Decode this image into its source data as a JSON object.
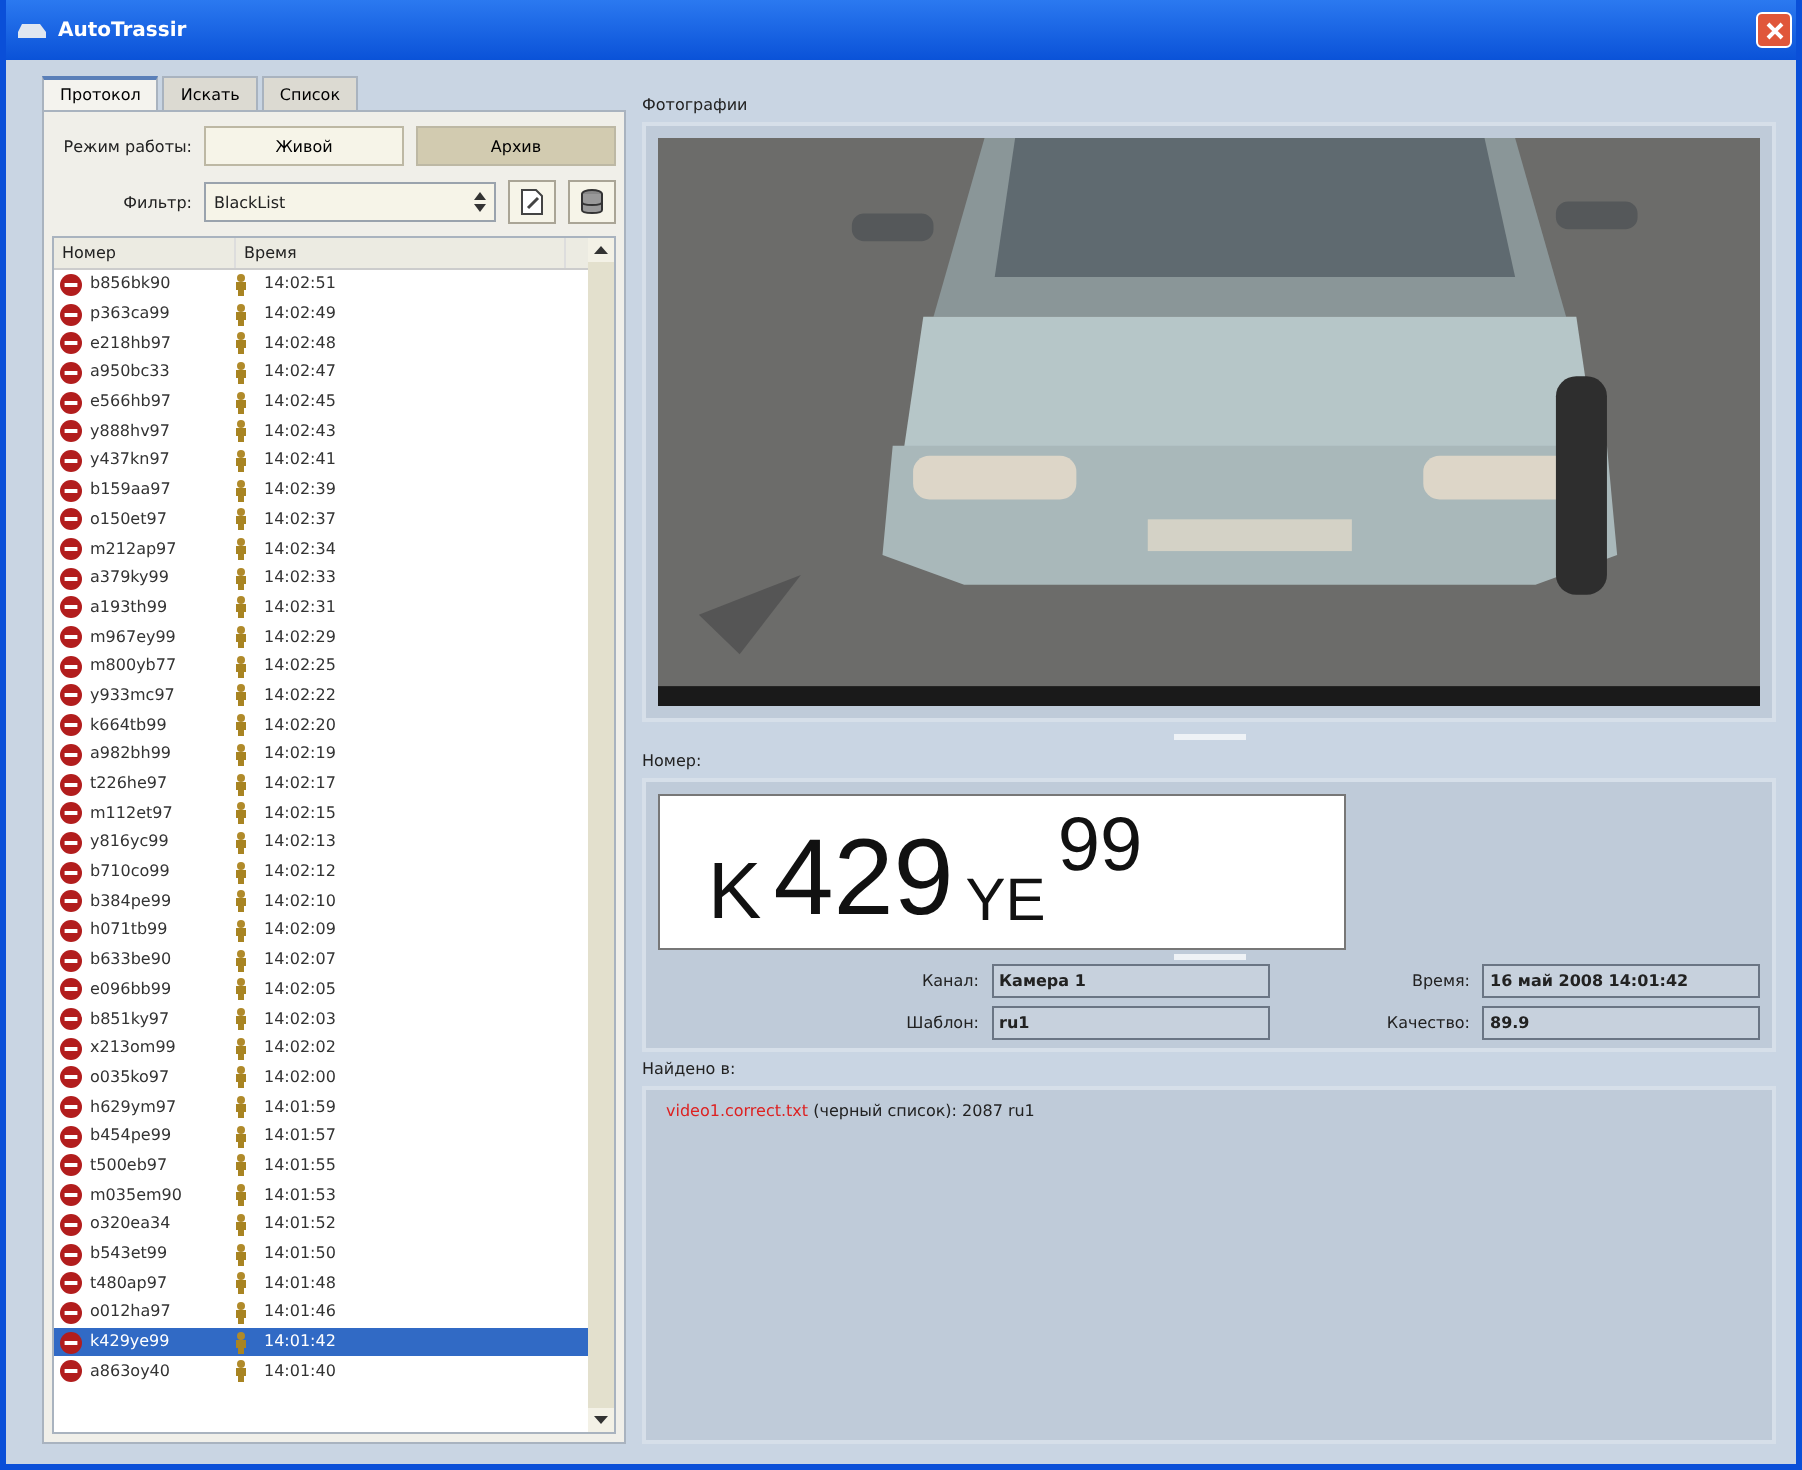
{
  "window": {
    "title": "AutoTrassir"
  },
  "tabs": [
    {
      "label": "Протокол",
      "selected": true
    },
    {
      "label": "Искать",
      "selected": false
    },
    {
      "label": "Список",
      "selected": false
    }
  ],
  "mode": {
    "label": "Режим работы:",
    "options": [
      {
        "label": "Живой",
        "selected": false
      },
      {
        "label": "Архив",
        "selected": true
      }
    ]
  },
  "filter": {
    "label": "Фильтр:",
    "value": "BlackList"
  },
  "list": {
    "columns": [
      "Номер",
      "Время"
    ],
    "rows": [
      {
        "number": "b856bk90",
        "time": "14:02:51",
        "selected": false
      },
      {
        "number": "p363ca99",
        "time": "14:02:49",
        "selected": false
      },
      {
        "number": "e218hb97",
        "time": "14:02:48",
        "selected": false
      },
      {
        "number": "a950bc33",
        "time": "14:02:47",
        "selected": false
      },
      {
        "number": "e566hb97",
        "time": "14:02:45",
        "selected": false
      },
      {
        "number": "y888hv97",
        "time": "14:02:43",
        "selected": false
      },
      {
        "number": "y437kn97",
        "time": "14:02:41",
        "selected": false
      },
      {
        "number": "b159aa97",
        "time": "14:02:39",
        "selected": false
      },
      {
        "number": "o150et97",
        "time": "14:02:37",
        "selected": false
      },
      {
        "number": "m212ap97",
        "time": "14:02:34",
        "selected": false
      },
      {
        "number": "a379ky99",
        "time": "14:02:33",
        "selected": false
      },
      {
        "number": "a193th99",
        "time": "14:02:31",
        "selected": false
      },
      {
        "number": "m967ey99",
        "time": "14:02:29",
        "selected": false
      },
      {
        "number": "m800yb77",
        "time": "14:02:25",
        "selected": false
      },
      {
        "number": "y933mc97",
        "time": "14:02:22",
        "selected": false
      },
      {
        "number": "k664tb99",
        "time": "14:02:20",
        "selected": false
      },
      {
        "number": "a982bh99",
        "time": "14:02:19",
        "selected": false
      },
      {
        "number": "t226he97",
        "time": "14:02:17",
        "selected": false
      },
      {
        "number": "m112et97",
        "time": "14:02:15",
        "selected": false
      },
      {
        "number": "y816yc99",
        "time": "14:02:13",
        "selected": false
      },
      {
        "number": "b710co99",
        "time": "14:02:12",
        "selected": false
      },
      {
        "number": "b384pe99",
        "time": "14:02:10",
        "selected": false
      },
      {
        "number": "h071tb99",
        "time": "14:02:09",
        "selected": false
      },
      {
        "number": "b633be90",
        "time": "14:02:07",
        "selected": false
      },
      {
        "number": "e096bb99",
        "time": "14:02:05",
        "selected": false
      },
      {
        "number": "b851ky97",
        "time": "14:02:03",
        "selected": false
      },
      {
        "number": "x213om99",
        "time": "14:02:02",
        "selected": false
      },
      {
        "number": "o035ko97",
        "time": "14:02:00",
        "selected": false
      },
      {
        "number": "h629ym97",
        "time": "14:01:59",
        "selected": false
      },
      {
        "number": "b454pe99",
        "time": "14:01:57",
        "selected": false
      },
      {
        "number": "t500eb97",
        "time": "14:01:55",
        "selected": false
      },
      {
        "number": "m035em90",
        "time": "14:01:53",
        "selected": false
      },
      {
        "number": "o320ea34",
        "time": "14:01:52",
        "selected": false
      },
      {
        "number": "b543et99",
        "time": "14:01:50",
        "selected": false
      },
      {
        "number": "t480ap97",
        "time": "14:01:48",
        "selected": false
      },
      {
        "number": "o012ha97",
        "time": "14:01:46",
        "selected": false
      },
      {
        "number": "k429ye99",
        "time": "14:01:42",
        "selected": true
      },
      {
        "number": "a863oy40",
        "time": "14:01:40",
        "selected": false
      }
    ]
  },
  "photo": {
    "label": "Фотографии",
    "kind": "picture"
  },
  "plate": {
    "label": "Номер:",
    "series": "K",
    "digits": "429",
    "letters": "YE",
    "region": "99"
  },
  "details": [
    {
      "label": "Канал:",
      "value": "Камера 1"
    },
    {
      "label": "Время:",
      "value": "16 май 2008 14:01:42"
    },
    {
      "label": "Шаблон:",
      "value": "ru1"
    },
    {
      "label": "Качество:",
      "value": "89.9"
    }
  ],
  "found": {
    "label": "Найдено в:",
    "source": "video1.correct.txt",
    "text": "(черный список): 2087 ru1"
  }
}
